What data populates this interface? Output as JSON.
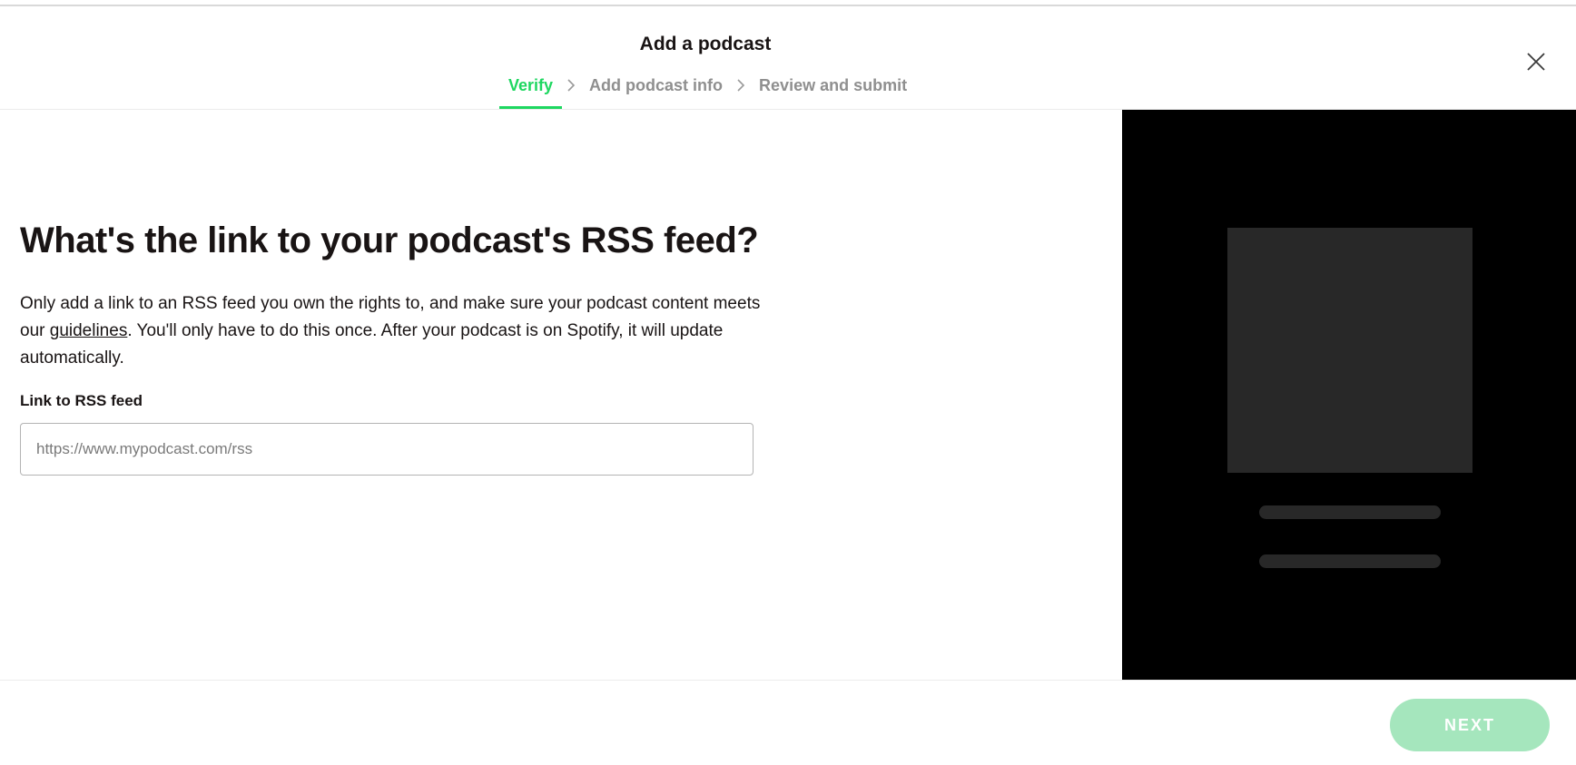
{
  "header": {
    "title": "Add a podcast",
    "steps": [
      {
        "label": "Verify",
        "active": true
      },
      {
        "label": "Add podcast info",
        "active": false
      },
      {
        "label": "Review and submit",
        "active": false
      }
    ],
    "step_separator_icon": "chevron-right-icon",
    "close_icon": "close-icon"
  },
  "main": {
    "heading": "What's the link to your podcast's RSS feed?",
    "description_before_link": "Only add a link to an RSS feed you own the rights to, and make sure your podcast content meets our ",
    "description_link": "guidelines",
    "description_after_link": ". You'll only have to do this once. After your podcast is on Spotify, it will update automatically.",
    "field_label": "Link to RSS feed",
    "field_value": "",
    "field_placeholder": "https://www.mypodcast.com/rss"
  },
  "preview": {
    "background_color": "#000000",
    "placeholder_color": "#282828"
  },
  "footer": {
    "next_label": "NEXT",
    "next_enabled": false
  },
  "colors": {
    "accent": "#1ed760",
    "button_disabled": "#a5e6bd",
    "text": "#191414",
    "muted": "#8f8f8f"
  }
}
